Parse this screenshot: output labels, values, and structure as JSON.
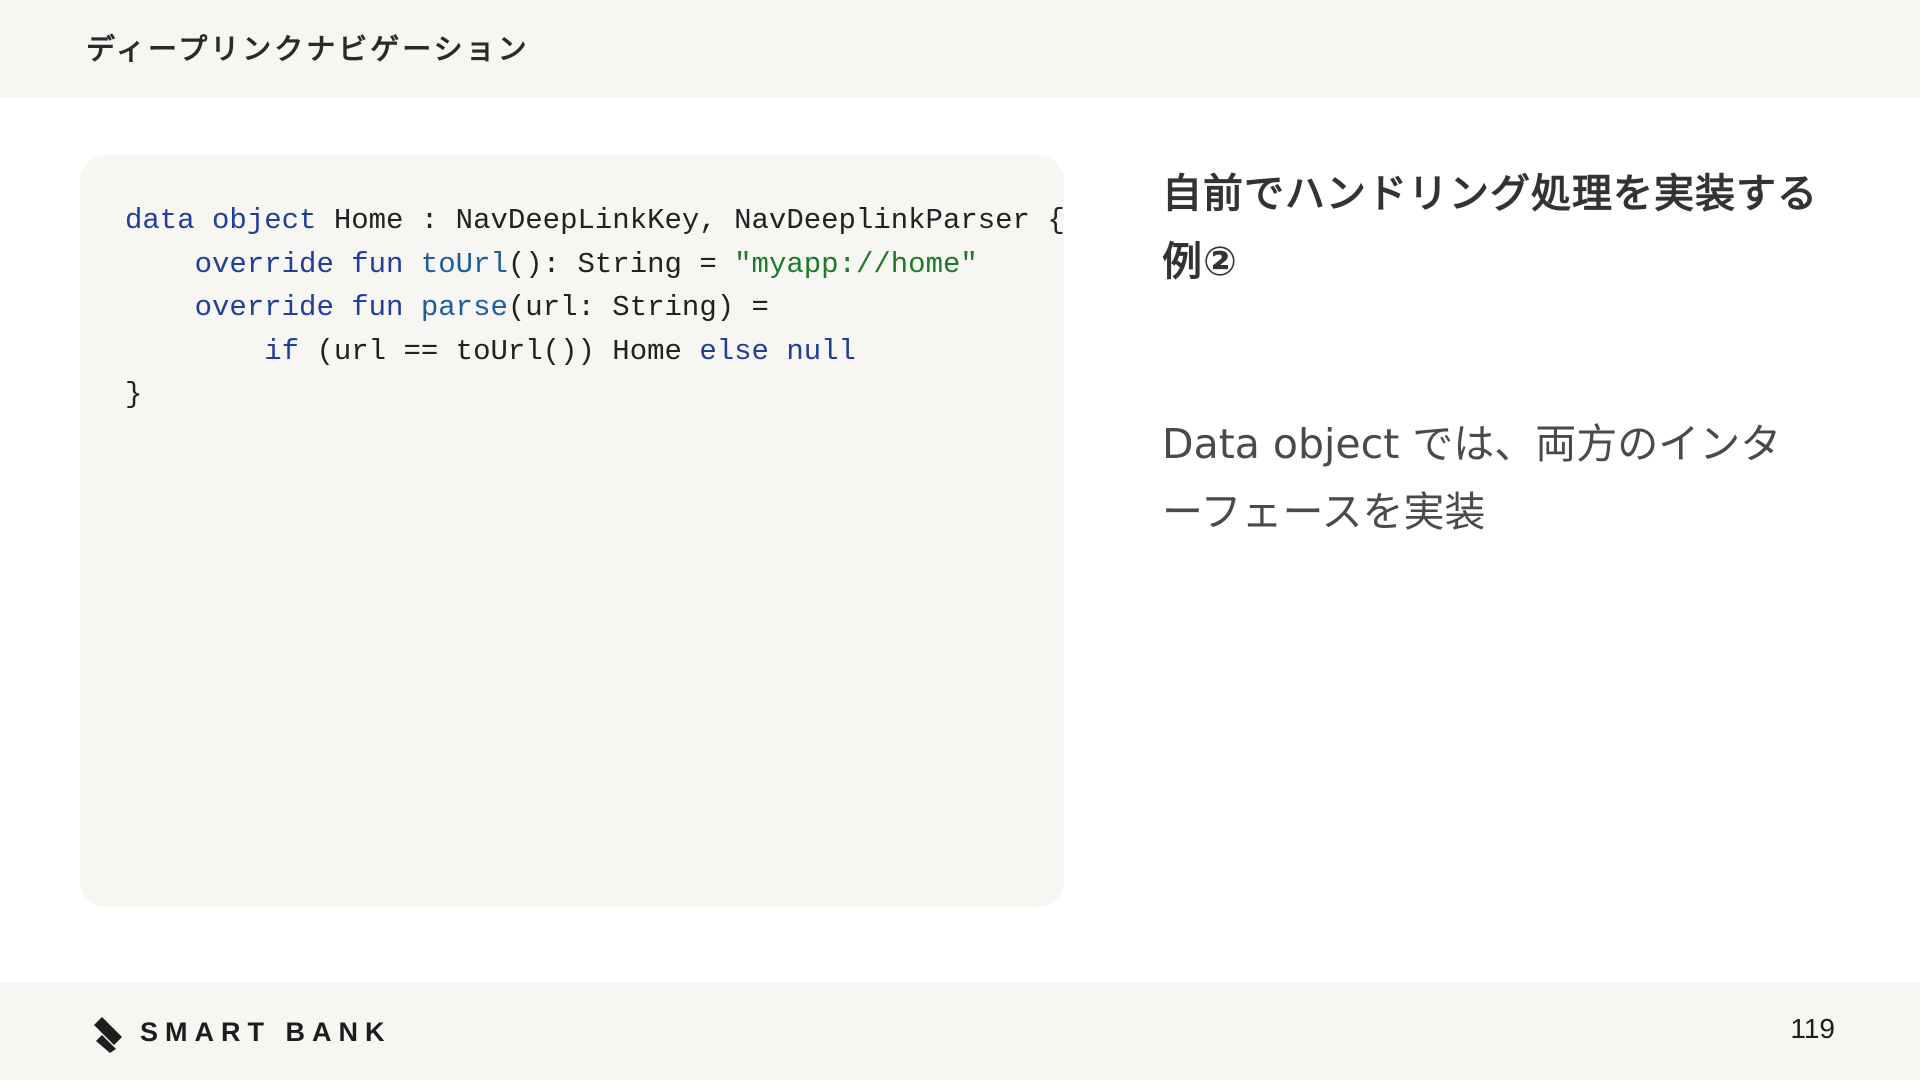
{
  "header": {
    "title": "ディープリンクナビゲーション"
  },
  "code": {
    "lines": [
      [
        {
          "text": "data object",
          "kind": "kw"
        },
        {
          "text": " Home : NavDeepLinkKey, NavDeeplinkParser {",
          "kind": "plain"
        }
      ],
      [
        {
          "text": "    ",
          "kind": "plain"
        },
        {
          "text": "override fun",
          "kind": "kw"
        },
        {
          "text": " ",
          "kind": "plain"
        },
        {
          "text": "toUrl",
          "kind": "fn"
        },
        {
          "text": "(): String = ",
          "kind": "plain"
        },
        {
          "text": "\"myapp://home\"",
          "kind": "str"
        }
      ],
      [
        {
          "text": "    ",
          "kind": "plain"
        },
        {
          "text": "override fun",
          "kind": "kw"
        },
        {
          "text": " ",
          "kind": "plain"
        },
        {
          "text": "parse",
          "kind": "fn"
        },
        {
          "text": "(url: String) =",
          "kind": "plain"
        }
      ],
      [
        {
          "text": "        ",
          "kind": "plain"
        },
        {
          "text": "if",
          "kind": "kw"
        },
        {
          "text": " (url == toUrl()) Home ",
          "kind": "plain"
        },
        {
          "text": "else null",
          "kind": "kw"
        }
      ],
      [
        {
          "text": "}",
          "kind": "plain"
        }
      ]
    ]
  },
  "side": {
    "heading": "自前でハンドリング処理を実装する例②",
    "body": "Data object では、両方のインターフェースを実装"
  },
  "footer": {
    "logo_text": "SMART BANK",
    "page_number": "119"
  },
  "colors": {
    "keyword": "#1f3f9a",
    "function": "#1f5e9e",
    "string": "#1f7a2a",
    "panel_background": "#f7f6f2"
  }
}
